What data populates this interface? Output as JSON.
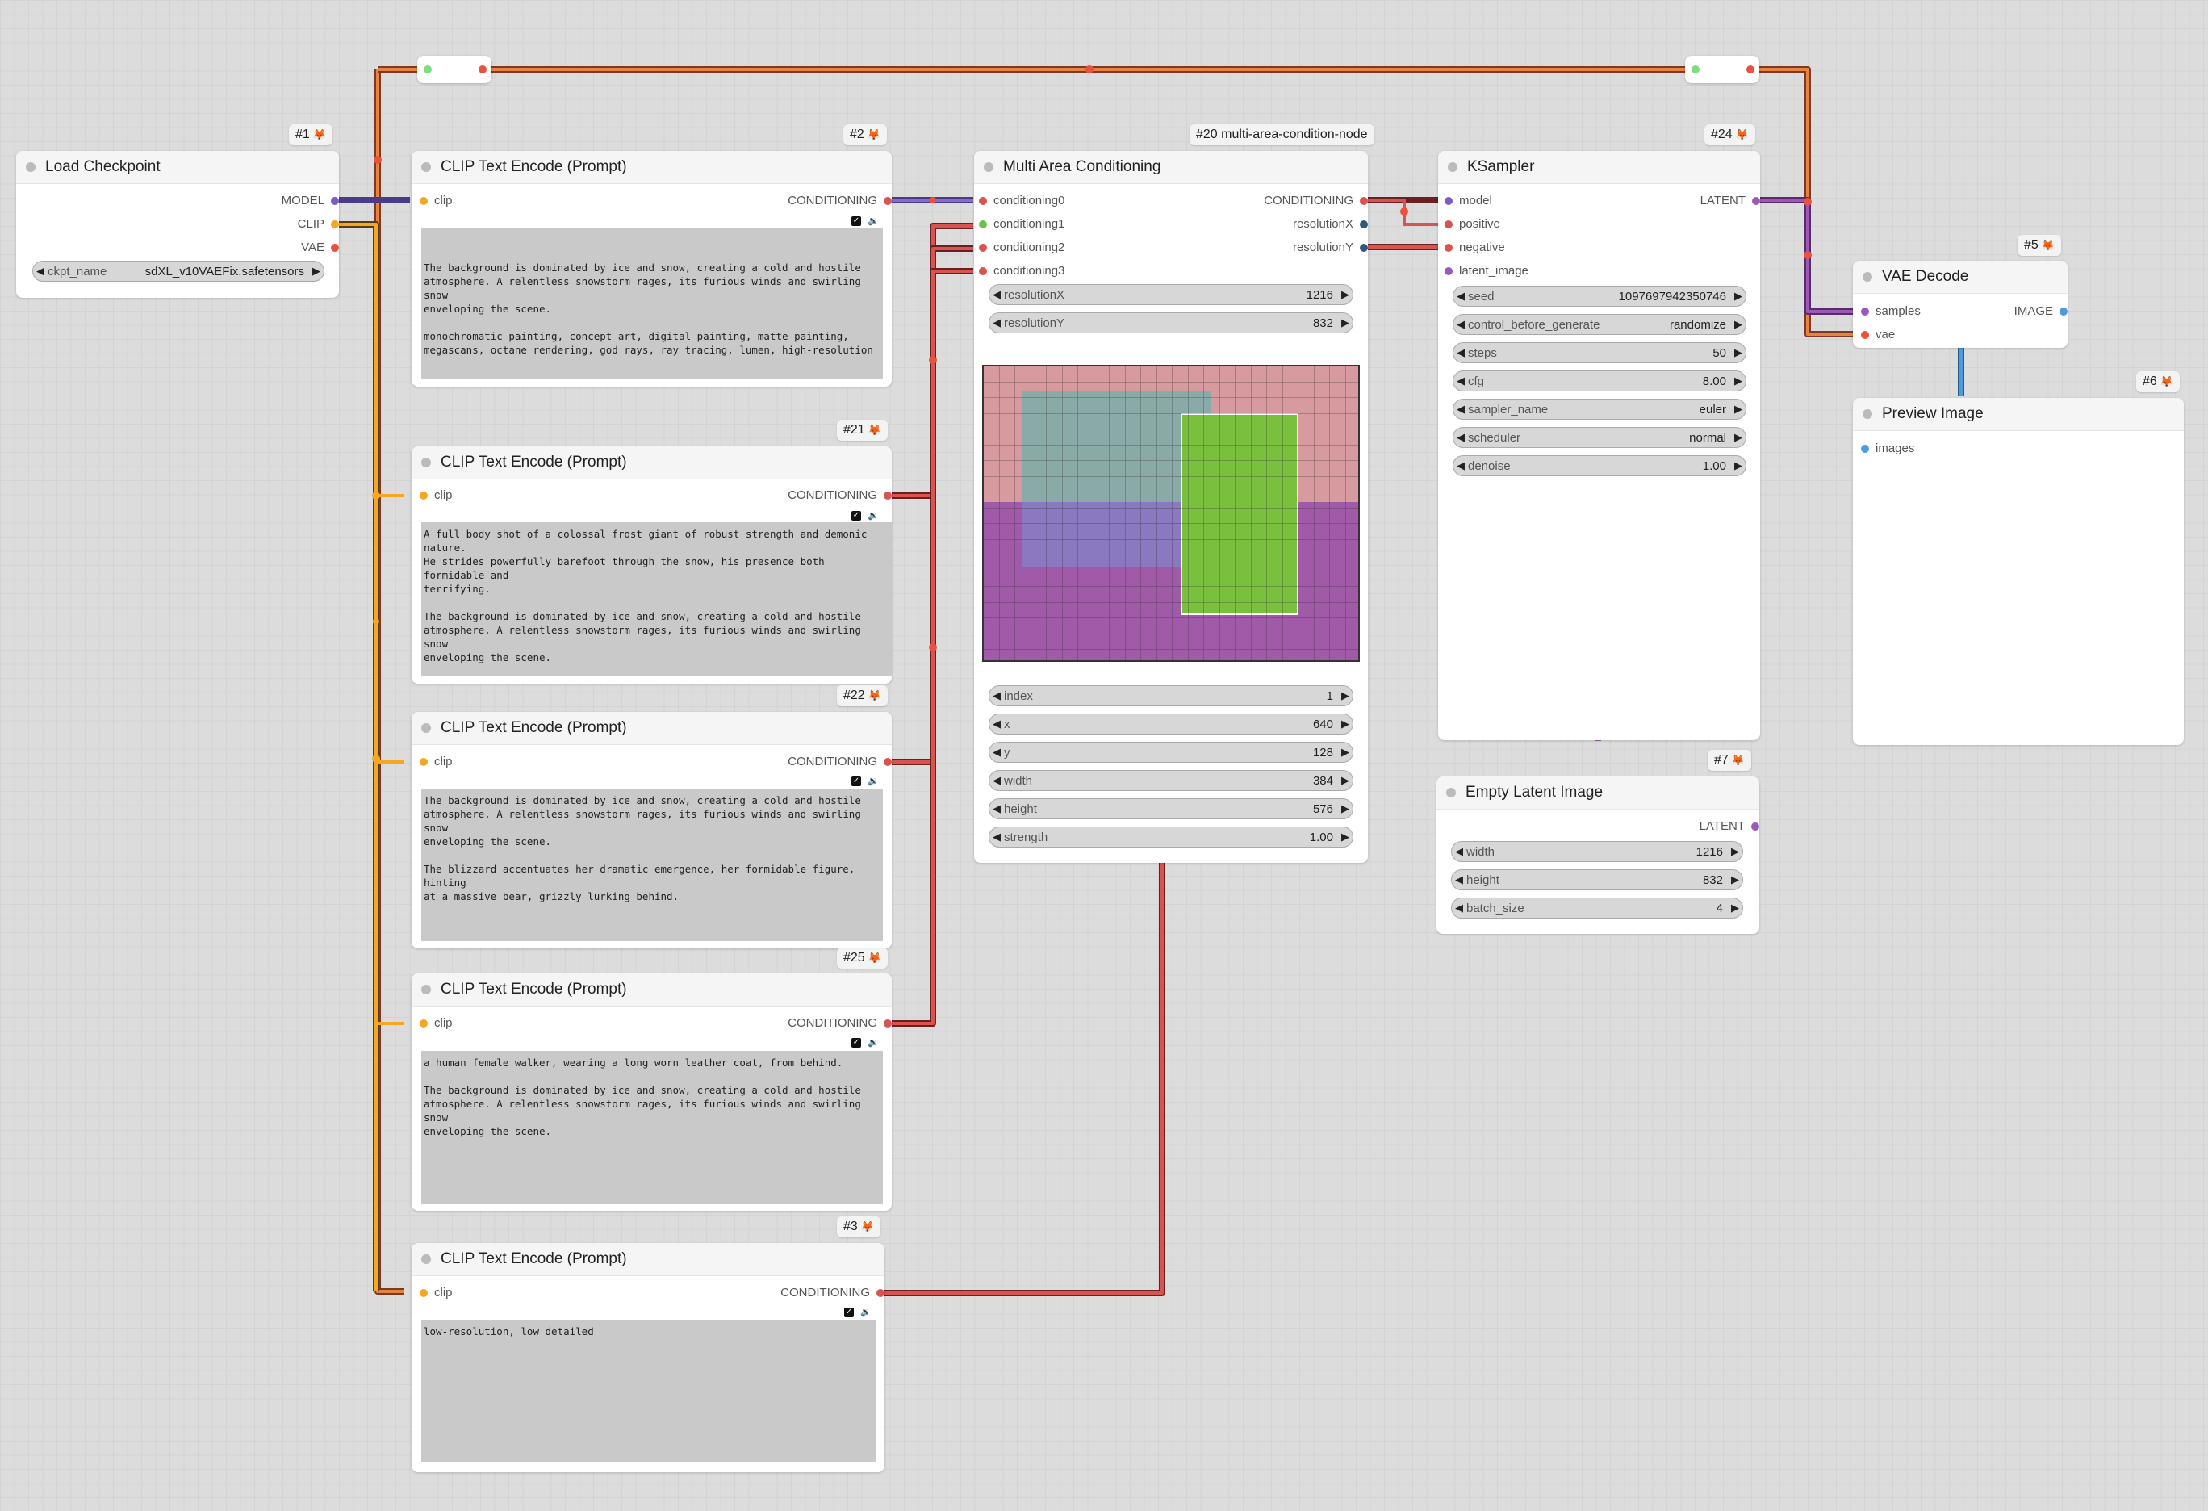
{
  "nodes": {
    "load_checkpoint": {
      "badge": "#1",
      "title": "Load Checkpoint",
      "outputs": [
        "MODEL",
        "CLIP",
        "VAE"
      ],
      "widget": {
        "label": "ckpt_name",
        "value": "sdXL_v10VAEFix.safetensors"
      }
    },
    "clip2": {
      "badge": "#2",
      "title": "CLIP Text Encode (Prompt)",
      "input": "clip",
      "output": "CONDITIONING",
      "text": "\n\nThe background is dominated by ice and snow, creating a cold and hostile\natmosphere. A relentless snowstorm rages, its furious winds and swirling snow\nenveloping the scene.\n\nmonochromatic painting, concept art, digital painting, matte painting,\nmegascans, octane rendering, god rays, ray tracing, lumen, high-resolution"
    },
    "clip21": {
      "badge": "#21",
      "title": "CLIP Text Encode (Prompt)",
      "input": "clip",
      "output": "CONDITIONING",
      "text": "A full body shot of a colossal frost giant of robust strength and demonic nature.\nHe strides powerfully barefoot through the snow, his presence both formidable and\nterrifying.\n\nThe background is dominated by ice and snow, creating a cold and hostile\natmosphere. A relentless snowstorm rages, its furious winds and swirling snow\nenveloping the scene."
    },
    "clip22": {
      "badge": "#22",
      "title": "CLIP Text Encode (Prompt)",
      "input": "clip",
      "output": "CONDITIONING",
      "text": "The background is dominated by ice and snow, creating a cold and hostile\natmosphere. A relentless snowstorm rages, its furious winds and swirling snow\nenveloping the scene.\n\nThe blizzard accentuates her dramatic emergence, her formidable figure, hinting\nat a massive bear, grizzly lurking behind."
    },
    "clip25": {
      "badge": "#25",
      "title": "CLIP Text Encode (Prompt)",
      "input": "clip",
      "output": "CONDITIONING",
      "text": "a human female walker, wearing a long worn leather coat, from behind.\n\nThe background is dominated by ice and snow, creating a cold and hostile\natmosphere. A relentless snowstorm rages, its furious winds and swirling snow\nenveloping the scene."
    },
    "clip3": {
      "badge": "#3",
      "title": "CLIP Text Encode (Prompt)",
      "input": "clip",
      "output": "CONDITIONING",
      "text": "low-resolution, low detailed"
    },
    "multi_area": {
      "badge": "#20 multi-area-condition-node",
      "title": "Multi Area Conditioning",
      "inputs": [
        "conditioning0",
        "conditioning1",
        "conditioning2",
        "conditioning3"
      ],
      "outputs": [
        "CONDITIONING",
        "resolutionX",
        "resolutionY"
      ],
      "widgets_top": [
        {
          "label": "resolutionX",
          "value": "1216"
        },
        {
          "label": "resolutionY",
          "value": "832"
        }
      ],
      "widgets_bottom": [
        {
          "label": "index",
          "value": "1"
        },
        {
          "label": "x",
          "value": "640"
        },
        {
          "label": "y",
          "value": "128"
        },
        {
          "label": "width",
          "value": "384"
        },
        {
          "label": "height",
          "value": "576"
        },
        {
          "label": "strength",
          "value": "1.00"
        }
      ]
    },
    "ksampler": {
      "badge": "#24",
      "title": "KSampler",
      "inputs": [
        "model",
        "positive",
        "negative",
        "latent_image"
      ],
      "output": "LATENT",
      "widgets": [
        {
          "label": "seed",
          "value": "1097697942350746"
        },
        {
          "label": "control_before_generate",
          "value": "randomize"
        },
        {
          "label": "steps",
          "value": "50"
        },
        {
          "label": "cfg",
          "value": "8.00"
        },
        {
          "label": "sampler_name",
          "value": "euler"
        },
        {
          "label": "scheduler",
          "value": "normal"
        },
        {
          "label": "denoise",
          "value": "1.00"
        }
      ]
    },
    "empty_latent": {
      "badge": "#7",
      "title": "Empty Latent Image",
      "output": "LATENT",
      "widgets": [
        {
          "label": "width",
          "value": "1216"
        },
        {
          "label": "height",
          "value": "832"
        },
        {
          "label": "batch_size",
          "value": "4"
        }
      ]
    },
    "vae_decode": {
      "badge": "#5",
      "title": "VAE Decode",
      "inputs": [
        "samples",
        "vae"
      ],
      "output": "IMAGE"
    },
    "preview": {
      "badge": "#6",
      "title": "Preview Image",
      "input": "images"
    }
  },
  "colors": {
    "model": "#7c5bc7",
    "clip": "#f5a623",
    "vae": "#e8523f",
    "conditioning": "#d9534f",
    "latent": "#9b59b6",
    "image": "#4a9be0"
  }
}
